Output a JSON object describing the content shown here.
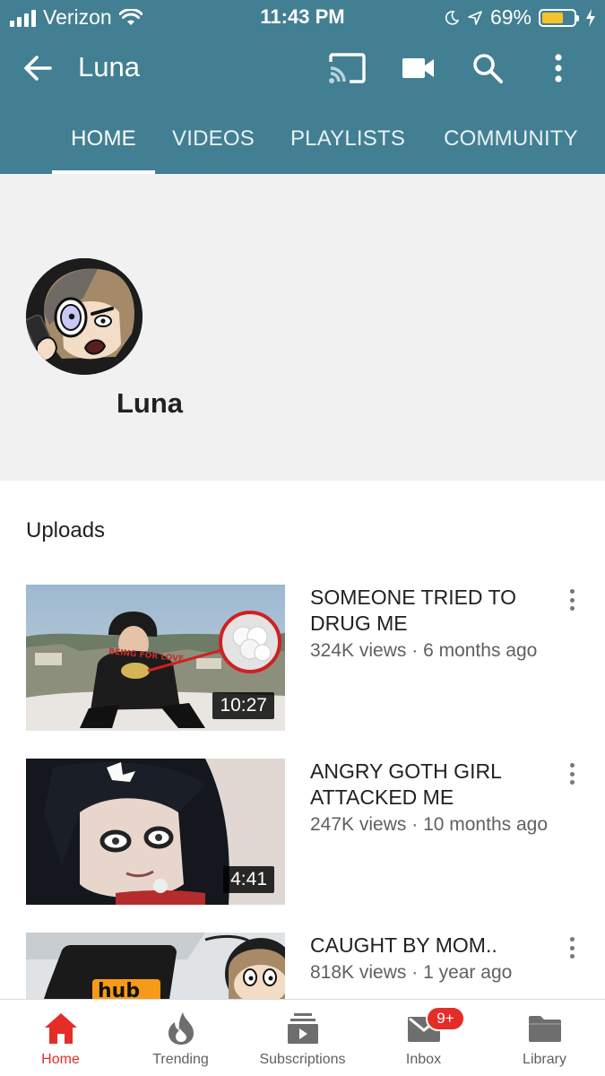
{
  "status_bar": {
    "carrier": "Verizon",
    "time": "11:43 PM",
    "battery_percent": "69%",
    "battery_level": 0.69,
    "battery_fill_color": "#f3c32c"
  },
  "app_bar": {
    "back_icon": "arrow-left-icon",
    "title": "Luna",
    "actions": [
      "cast-icon",
      "video-camera-icon",
      "search-icon",
      "more-vert-icon"
    ],
    "background_color": "#427f92"
  },
  "tabs": [
    {
      "label": "HOME",
      "active": true
    },
    {
      "label": "VIDEOS",
      "active": false
    },
    {
      "label": "PLAYLISTS",
      "active": false
    },
    {
      "label": "COMMUNITY",
      "active": false
    }
  ],
  "channel": {
    "name": "Luna"
  },
  "uploads": {
    "title": "Uploads",
    "videos": [
      {
        "title": "SOMEONE TRIED TO DRUG ME",
        "views": "324K views",
        "age": "6 months ago",
        "duration": "10:27"
      },
      {
        "title": "ANGRY GOTH GIRL ATTACKED ME",
        "views": "247K views",
        "age": "10 months ago",
        "duration": "4:41"
      },
      {
        "title": "CAUGHT BY MOM..",
        "views": "818K views",
        "age": "1 year ago",
        "duration": ""
      }
    ]
  },
  "thumb_text": {
    "shirt": "BEING FOR LOVE",
    "laptop": "hub"
  },
  "meta_separator": " · ",
  "bottom_nav": {
    "accent_color": "#e52d27",
    "items": [
      {
        "label": "Home",
        "icon": "home-icon",
        "active": true
      },
      {
        "label": "Trending",
        "icon": "flame-icon",
        "active": false
      },
      {
        "label": "Subscriptions",
        "icon": "subscriptions-icon",
        "active": false
      },
      {
        "label": "Inbox",
        "icon": "inbox-icon",
        "active": false,
        "badge": "9+"
      },
      {
        "label": "Library",
        "icon": "folder-icon",
        "active": false
      }
    ]
  }
}
